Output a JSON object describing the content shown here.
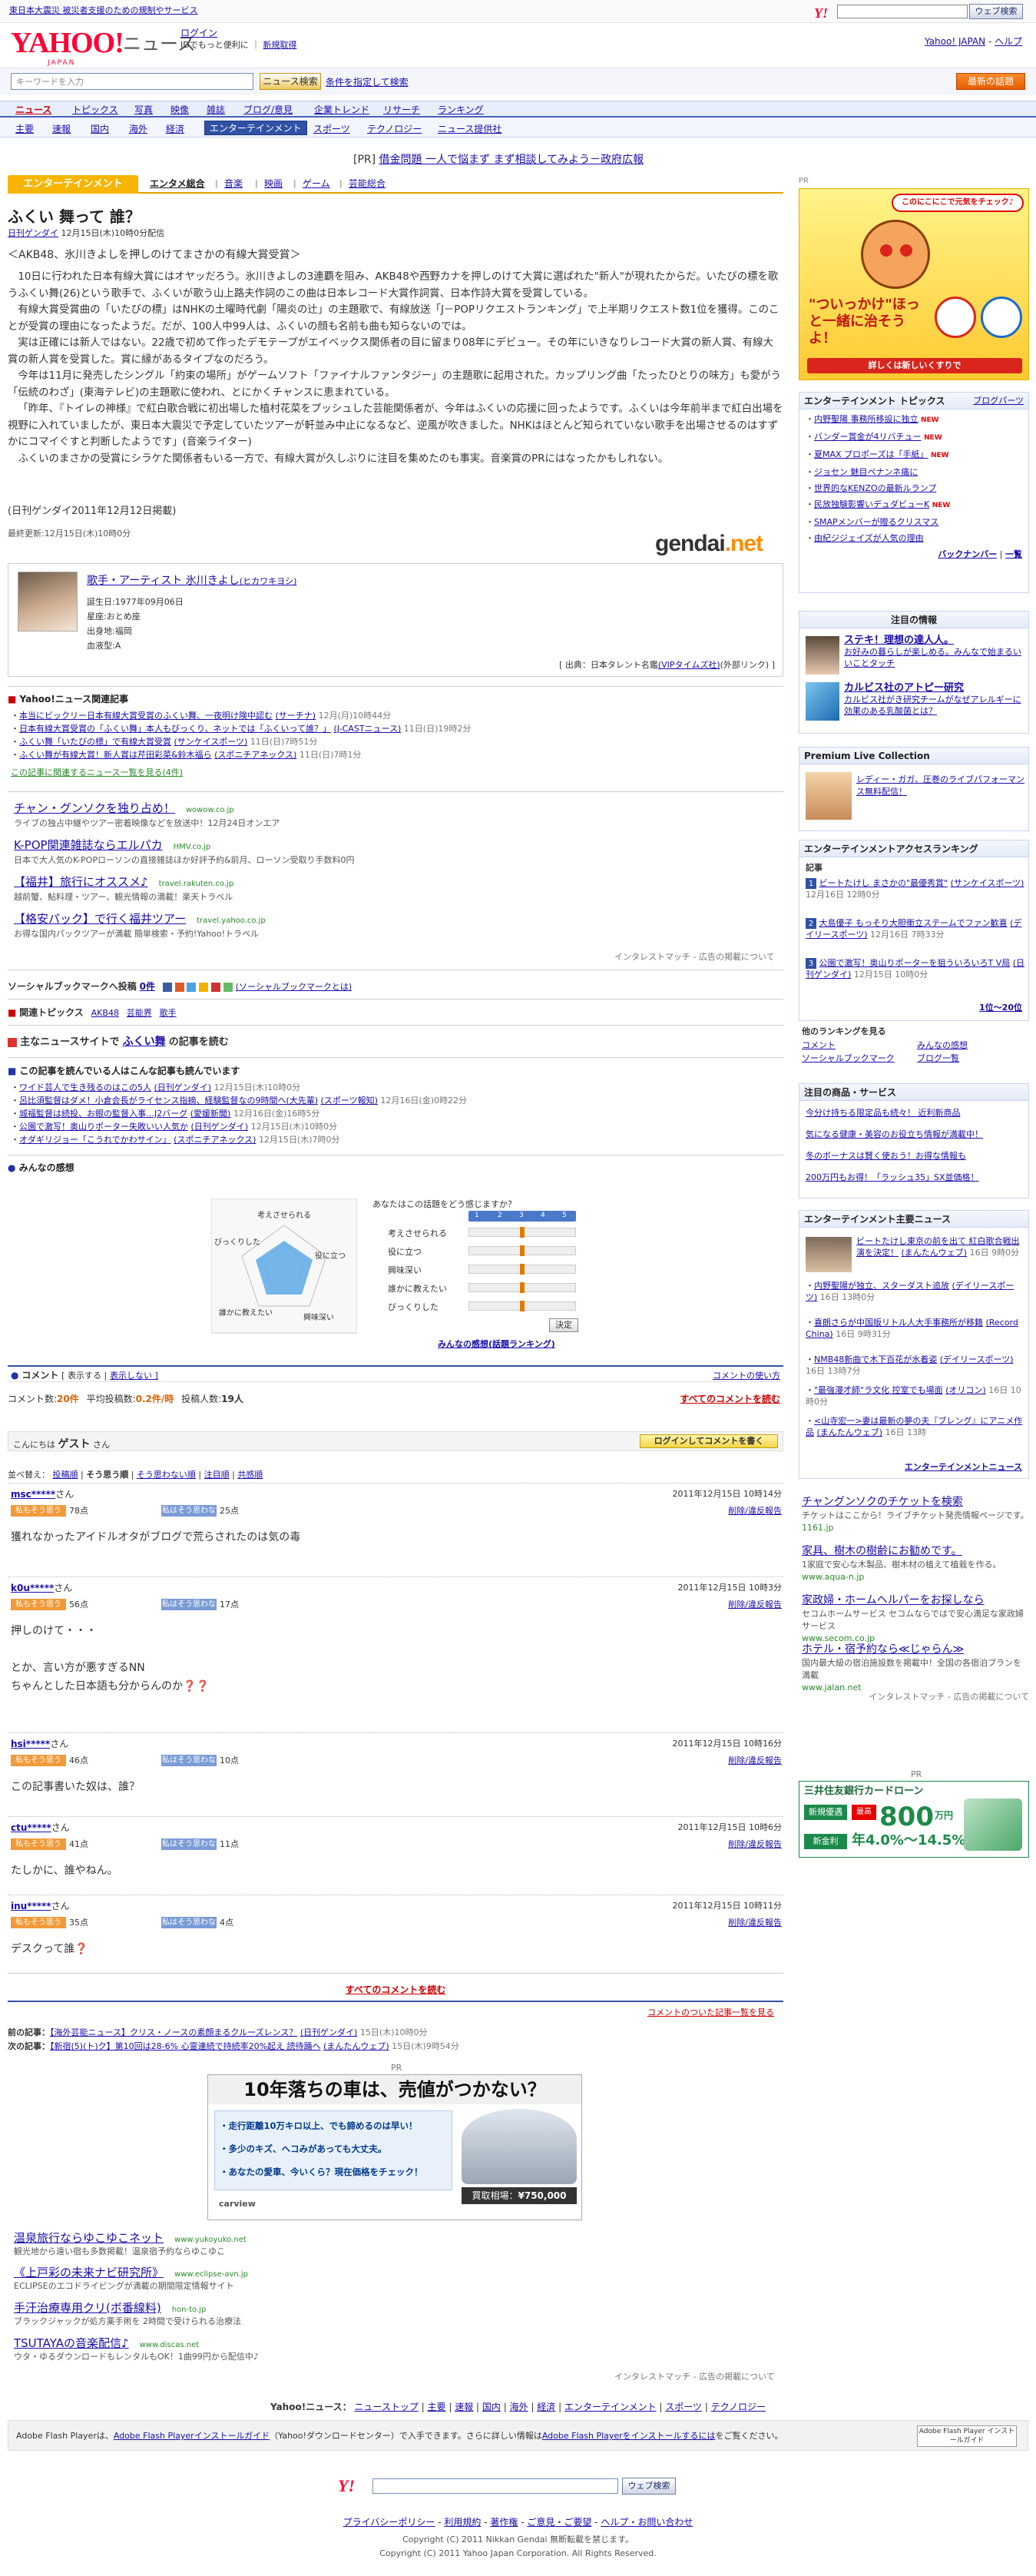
{
  "top": {
    "notice": "東日本大震災 被災者支援のための規制やサービス",
    "search_btn": "ウェブ検索",
    "small_logo": "Y!"
  },
  "header": {
    "logo": "YAHOO!",
    "logo_sub": "JAPAN",
    "service": "ニュース",
    "login": "ログイン",
    "login_note": "IDでもっと便利に",
    "signup": "新規取得",
    "yahoo_top": "Yahoo! JAPAN",
    "help": "ヘルプ"
  },
  "search": {
    "placeholder": "キーワードを入力",
    "button": "ニュース検索",
    "cond": "条件を指定して検索",
    "latest": "最新の話題"
  },
  "nav1": [
    "ニュース",
    "トピックス",
    "写真",
    "映像",
    "雑誌",
    "ブログ/意見",
    "企業トレンド",
    "リサーチ",
    "ランキング"
  ],
  "nav2": [
    "主要",
    "速報",
    "国内",
    "海外",
    "経済",
    "エンターテインメント",
    "スポーツ",
    "テクノロジー",
    "ニュース提供社"
  ],
  "pr_line": {
    "pr": "[PR]",
    "link": "借金問題 一人で悩まず まず相談してみよう－政府広報"
  },
  "category": {
    "label": "エンターテインメント",
    "tabs": [
      "エンタメ総合",
      "音楽",
      "映画",
      "ゲーム",
      "芸能総合"
    ]
  },
  "article": {
    "title": "ふくい 舞って 誰？",
    "source": "日刊ゲンダイ",
    "datetime": "12月15日(木)10時0分配信",
    "lead": "＜AKB48、氷川きよしを押しのけてまさかの有線大賞受賞＞",
    "paragraphs": [
      "10日に行われた日本有線大賞にはオヤッだろう。氷川きよしの3連覇を阻み、AKB48や西野カナを押しのけて大賞に選ばれた\"新人\"が現れたからだ。いたびの標を歌うふくい舞(26)という歌手で、ふくいが歌う山上路夫作詞のこの曲は日本レコード大賞作詞賞、日本作詩大賞を受賞している。",
      "有線大賞受賞曲の「いたびの標」はNHKの土曜時代劇「陽炎の辻」の主題歌で、有線放送「J－POPリクエストランキング」で上半期リクエスト数1位を獲得。このことが受賞の理由になったようだ。だが、100人中99人は、ふくいの顔も名前も曲も知らないのでは。",
      "実は正確には新人ではない。22歳で初めて作ったデモテープがエイベックス関係者の目に留まり08年にデビュー。その年にいきなりレコード大賞の新人賞、有線大賞の新人賞を受賞した。賞に縁があるタイプなのだろう。",
      "今年は11月に発売したシングル「約束の場所」がゲームソフト「ファイナルファンタジー」の主題歌に起用された。カップリング曲「たったひとりの味方」も愛がう「伝統のわざ」(東海テレビ)の主題歌に使われ、とにかくチャンスに恵まれている。",
      "「昨年、『トイレの神様』で紅白歌合戦に初出場した植村花菜をプッシュした芸能関係者が、今年はふくいの応援に回ったようです。ふくいは今年前半まで紅白出場を視野に入れていましたが、東日本大震災で予定していたツアーが軒並み中止になるなど、逆風が吹きました。NHKはほとんど知られていない歌手を出場させるのはすずかにコマイぐすと判断したようです」(音楽ライター)",
      "ふくいのまさかの受賞にシラケた関係者もいる一方で、有線大賞が久しぶりに注目を集めたのも事実。音楽賞のPRにはなったかもしれない。"
    ],
    "credit": "(日刊ゲンダイ2011年12月12日掲載)",
    "updated": "最終更新:12月15日(木)10時0分",
    "gendai": "gendai",
    "gendai_suffix": ".net"
  },
  "artist": {
    "name": "歌手・アーティスト 氷川きよし",
    "kana": "(ヒカワキヨシ)",
    "info": [
      "誕生日:1977年09月06日",
      "星座:おとめ座",
      "出身地:福岡",
      "血液型:A"
    ],
    "source_label": "[ 出典：日本タレント名鑑",
    "source_link": "(VIPタイムズ社)",
    "source_ext": "(外部リンク) ]"
  },
  "related_news": {
    "header": "Yahoo!ニュース関連記事",
    "items": [
      {
        "text": "本当にビックリー日本有線大賞受賞のふくい舞、一夜明け険中認む",
        "src": "(サーチナ)",
        "time": "12月(月)10時44分"
      },
      {
        "text": "日本有線大賞受賞の「ふくい舞」本人もびっくり、ネットでは「ふくいって誰？」",
        "src": "(J-CASTニュース)",
        "time": "11日(日)19時2分"
      },
      {
        "text": "ふくい舞「いたびの標」で有線大賞受賞",
        "src": "(サンケイスポーツ)",
        "time": "11日(日)7時51分"
      },
      {
        "text": "ふくい舞が有線大賞！新人賞は芹田彩菜&鈴木福ら",
        "src": "(スポニチアネックス)",
        "time": "11日(日)7時1分"
      }
    ],
    "more": "この記事に関連するニュース一覧を見る(4件)"
  },
  "ads1": [
    {
      "title": "チャン・グンソクを独り占め！",
      "url": "wowow.co.jp",
      "desc": "ライブの独占中継やツアー密着映像などを放送中！12月24日オンエア"
    },
    {
      "title": "K-POP関連雑誌ならエルパカ",
      "url": "HMV.co.jp",
      "desc": "日本で大人気のK-POPローソンの直接雑誌ほか好評予約&前月、ローソン受取り手数料0円"
    },
    {
      "title": "【福井】旅行にオススメ♪",
      "url": "travel.rakuten.co.jp",
      "desc": "越前蟹、鮎料理・ツアー、観光情報の満載！楽天トラベル"
    },
    {
      "title": "【格安パック】で行く福井ツアー",
      "url": "travel.yahoo.co.jp",
      "desc": "お得な国内パックツアーが満載 簡単検索・予約!Yahoo!トラベル"
    }
  ],
  "ads_footer": "インタレストマッチ - 広告の掲載について",
  "bookmark": {
    "label": "ソーシャルブックマークへ投稿",
    "count": "0件",
    "link": "(ソーシャルブックマークとは)"
  },
  "topics": {
    "label": "関連トピックス",
    "items": [
      "AKB48",
      "芸能界",
      "歌手"
    ]
  },
  "other_site": {
    "prefix": "主なニュースサイトで",
    "keyword": "ふくい舞",
    "suffix": "の記事を読む"
  },
  "also_read": {
    "header": "この記事を読んでいる人はこんな記事も読んでいます",
    "items": [
      {
        "text": "ワイド芸人で生き残るのはこの5人",
        "src": "(日刊ゲンダイ)",
        "time": "12月15日(木)10時0分"
      },
      {
        "text": "呂比須監督はダメ！小倉会長がライセンス指摘、経験監督なの9時間へ(大先輩)",
        "src": "(スポーツ報知)",
        "time": "12月16日(金)0時22分"
      },
      {
        "text": "城福監督は続投、お眼の監督入事…J2バーグ",
        "src": "(愛媛新聞)",
        "time": "12月16日(金)16時5分"
      },
      {
        "text": "公園で激写！奥山りポーター失敗いい人気か",
        "src": "(日刊ゲンダイ)",
        "time": "12月15日(木)10時0分"
      },
      {
        "text": "オダギリジョー「こうれでかわサイン」",
        "src": "(スポニチアネックス)",
        "time": "12月15日(木)7時0分"
      }
    ]
  },
  "survey": {
    "header": "みんなの感想",
    "question": "あなたはこの話題をどう感じますか？",
    "axes": [
      "考えさせられる",
      "役に立つ",
      "興味深い",
      "誰かに教えたい",
      "びっくりした"
    ],
    "scale": [
      "1",
      "2",
      "3",
      "4",
      "5"
    ],
    "button": "決定",
    "link": "みんなの感想(話題ランキング)"
  },
  "comments": {
    "head_label": "コメント",
    "show": "[ 表示する |",
    "hide": "表示しない ]",
    "policy": "コメントの使い方",
    "count_label": "コメント数:",
    "count": "20件",
    "avg_label": "平均投稿数:",
    "avg": "0.2件/時",
    "posters_label": "投稿人数:",
    "posters": "19人",
    "all_link": "すべてのコメントを読む",
    "greet_prefix": "こんにちは",
    "guest": "ゲスト",
    "greet_suffix": "さん",
    "login_btn": "ログインしてコメントを書く",
    "sort_label": "並べ替え",
    "sorts": [
      "投稿順",
      "そう思う順",
      "そう思わない順",
      "注目順",
      "共感順"
    ],
    "agree_label": "私もそう思う",
    "disagree_label": "私はそう思わない",
    "report": "削除/違反報告",
    "items": [
      {
        "user": "msc*****",
        "date": "2011年12月15日 10時14分",
        "agree": "78点",
        "dis": "25点",
        "text": "獲れなかったアイドルオタがブログで荒らされたのは気の毒"
      },
      {
        "user": "k0u*****",
        "date": "2011年12月15日 10時3分",
        "agree": "56点",
        "dis": "17点",
        "text": "押しのけて・・・\n\nとか、言い方が悪すぎるNN\nちゃんとした日本語も分からんのか❓❓"
      },
      {
        "user": "hsi*****",
        "date": "2011年12月15日 10時16分",
        "agree": "46点",
        "dis": "10点",
        "text": "この記事書いた奴は、誰？"
      },
      {
        "user": "ctu*****",
        "date": "2011年12月15日 10時6分",
        "agree": "41点",
        "dis": "11点",
        "text": "たしかに、誰やねん。"
      },
      {
        "user": "inu*****",
        "date": "2011年12月15日 10時11分",
        "agree": "35点",
        "dis": "4点",
        "text": "デスクって誰❓"
      }
    ],
    "read_all": "すべてのコメントを読む",
    "ranking_link": "コメントのついた記事一覧を見る"
  },
  "prevnext": {
    "prev_label": "前の記事：",
    "prev": "【海外芸能ニュース】クリス・ノースの素顔まるクルーズレンス？",
    "prev_src": "(日刊ゲンダイ)",
    "prev_time": "15日(木)10時0分",
    "next_label": "次の記事：",
    "next": "【新宿(5)(ト)ク】第10回は28-6% 心霊連続で持続率20%起え 読待踊へ",
    "next_src": "(まんたんウェブ)",
    "next_time": "15日(木)9時54分"
  },
  "car_ad": {
    "pr": "PR",
    "title": "10年落ちの車は、売値がつかない？",
    "lines": [
      "・走行距離10万キロ以上、でも諦めるのは早い！",
      "・多少のキズ、ヘコみがあっても大丈夫。",
      "・あなたの愛車、今いくら？現在価格をチェック！"
    ],
    "price_label": "買取相場：",
    "price": "¥750,000",
    "brand": "carview"
  },
  "ads2": [
    {
      "title": "温泉旅行ならゆこゆこネット",
      "url": "www.yukoyuko.net",
      "desc": "観光地から遠い宿も多数掲載！温泉宿予約ならゆこゆこ"
    },
    {
      "title": "《上戸彩の未来ナビ研究所》",
      "url": "www.eclipse-avn.jp",
      "desc": "ECLIPSEのエコドライビングが満載の期間限定情報サイト"
    },
    {
      "title": "手汗治療専用クリ(ボ番線料)",
      "url": "hon-to.jp",
      "desc": "ブラックジャックが処方薬手術を 2時間で受けられる治療法"
    },
    {
      "title": "TSUTAYAの音楽配信♪",
      "url": "www.discas.net",
      "desc": "ウタ・ゆるダウンロードもレンタルもOK！1曲99円から配信中♪"
    }
  ],
  "ads2_footer": "インタレストマッチ - 広告の掲載について",
  "footer_nav": {
    "label": "Yahoo!ニュース：",
    "items": [
      "ニューストップ",
      "主要",
      "速報",
      "国内",
      "海外",
      "経済",
      "エンターテインメント",
      "スポーツ",
      "テクノロジー"
    ]
  },
  "flash": {
    "text1": "Adobe Flash Playerは、",
    "link1": "Adobe Flash Playerインストールガイド",
    "text2": "（Yahoo!ダウンロードセンター）で入手できます。さらに詳しい情報は",
    "link2": "Adobe Flash Playerをインストールするには",
    "text3": "をご覧ください。",
    "btn": "Adobe Flash Player インストールガイド"
  },
  "foot_search_btn": "ウェブ検索",
  "foot_links": [
    "プライバシーポリシー",
    "利用規約",
    "著作権",
    "ご意見・ご要望",
    "ヘルプ・お問い合わせ"
  ],
  "copyright1": "Copyright (C) 2011 Nikkan Gendai 無断転載を禁じます。",
  "copyright2": "Copyright (C) 2011 Yahoo Japan Corporation. All Rights Reserved.",
  "sidebar": {
    "pr": "PR",
    "anpanman_badge": "このにこにこで元気をチェック♪",
    "anpanman_title": "\"ついっかけ\"ほっと一緒に治そうよ！",
    "anpanman_cta": "詳しくは新しいくすりで",
    "ent_topics": {
      "header": "エンターテインメント トピックス",
      "more": "ブログパーツ",
      "items": [
        "内野聖陽 事務所移設に独立",
        "バンダー賞金が4リバチュー",
        "夏MAX プロポーズは「手紙」",
        "ジョセン 魅目ペナンネ痛に",
        "世界的なKENZOの最新ルランプ",
        "民放独験影響いデュダビューK",
        "SMAPメンバーが贈るクリスマス",
        "由紀ジジェイズが人気の理由"
      ],
      "backnumber": "バックナンバー",
      "list": "一覧"
    },
    "featured": {
      "header": "注目の情報",
      "items": [
        {
          "title": "ステキ！理想の達人人。",
          "desc": "お好みの暮らしが楽しめる。みんなで始まるいいことタッチ"
        },
        {
          "title": "カルビス社のアトピー研究",
          "desc": "カルビス社がき研究チームがなぜアレルギーに効果のある乳酸菌とは？"
        }
      ]
    },
    "premium": {
      "header": "Premium Live Collection",
      "link": "レディー・ガガ、圧巻のライブパフォーマンス無料配信！"
    },
    "ranking": {
      "header": "エンターテインメントアクセスランキング",
      "sub": "記事",
      "items": [
        {
          "n": "1",
          "text": "ビートたけし まさかの\"最優秀賞\"",
          "src": "(サンケイスポーツ)",
          "time": "12月16日 12時0分"
        },
        {
          "n": "2",
          "text": "大島優子 もっそり大胆衝立ステームでファン歓喜",
          "src": "(デイリースポーツ)",
          "time": "12月16日 7時33分"
        },
        {
          "n": "3",
          "text": "公園で激写！奥山りポーターを狙ういろいろT V局",
          "src": "(日刊ゲンダイ)",
          "time": "12月15日 10時0分"
        }
      ],
      "more": "1位～20位"
    },
    "other_rankings": {
      "header": "他のランキングを見る",
      "items": [
        "コメント",
        "みんなの感想",
        "ソーシャルブックマーク",
        "ブログ一覧"
      ]
    },
    "products": {
      "header": "注目の商品・サービス",
      "items": [
        "今分け持ちる限定品も続々！ 近利新商品",
        "気になる健康・美容のお役立ち情報が満載中！",
        "冬のボーナスは賢く使おう！お得な情報も",
        "200万円もお得！「ラッシュ35」SX並価格！"
      ]
    },
    "ent_news": {
      "header": "エンターテインメント主要ニュース",
      "items": [
        {
          "text": "ビートたけし東京の前を出て 紅白歌合戦出演を決定！",
          "src": "(まんたんウェブ)",
          "time": "16日 9時0分"
        },
        {
          "text": "内野聖陽が独立、スターダスト追放",
          "src": "(デイリースポーツ)",
          "time": "16日 13時0分"
        },
        {
          "text": "喜朗さらが中国版リトル人大手事務所が移籍",
          "src": "(Record China)",
          "time": "16日 9時31分"
        },
        {
          "text": "NMB48新曲で木下百花が水着姿",
          "src": "(デイリースポーツ)",
          "time": "16日 13時7分"
        },
        {
          "text": "\"最強漫才師\"ラ文化 控室でも場面",
          "src": "(オリコン)",
          "time": "16日 10時0分"
        },
        {
          "text": "<山寺宏一>妻は最新の夢の夫『ブレング』にアニメ作品",
          "src": "(まんたんウェブ)",
          "time": "16日 13時"
        }
      ],
      "more": "エンターテインメントニュース"
    },
    "ads": [
      {
        "title": "チャングンソクのチケットを検索",
        "desc": "チケットはここから！ライブチケット発売情報ページです。",
        "url": "1161.jp"
      },
      {
        "title": "家具、樹木の樹齢にお勧めです。",
        "desc": "1家庭で安心な木製品、樹木材の植えて植栽を作る。",
        "url": "www.aqua-n.jp"
      },
      {
        "title": "家政婦・ホームヘルパーをお探しなら",
        "desc": "セコムホームサービス セコムならではで安心満足な家政婦サービス",
        "url": "www.secom.co.jp"
      },
      {
        "title": "ホテル・宿予約なら≪じゃらん≫",
        "desc": "国内最大級の宿泊施設数を掲載中！全国の各宿泊プランを満載",
        "url": "www.jalan.net"
      }
    ],
    "ads_footer": "インタレストマッチ - 広告の掲載について",
    "card": {
      "pr": "PR",
      "title": "三井住友銀行カードローン",
      "badge": "新規優遇",
      "rate_label": "最高",
      "rate": "800",
      "unit": "万円",
      "sub": "新金利",
      "range": "年4.0%～14.5%"
    }
  }
}
